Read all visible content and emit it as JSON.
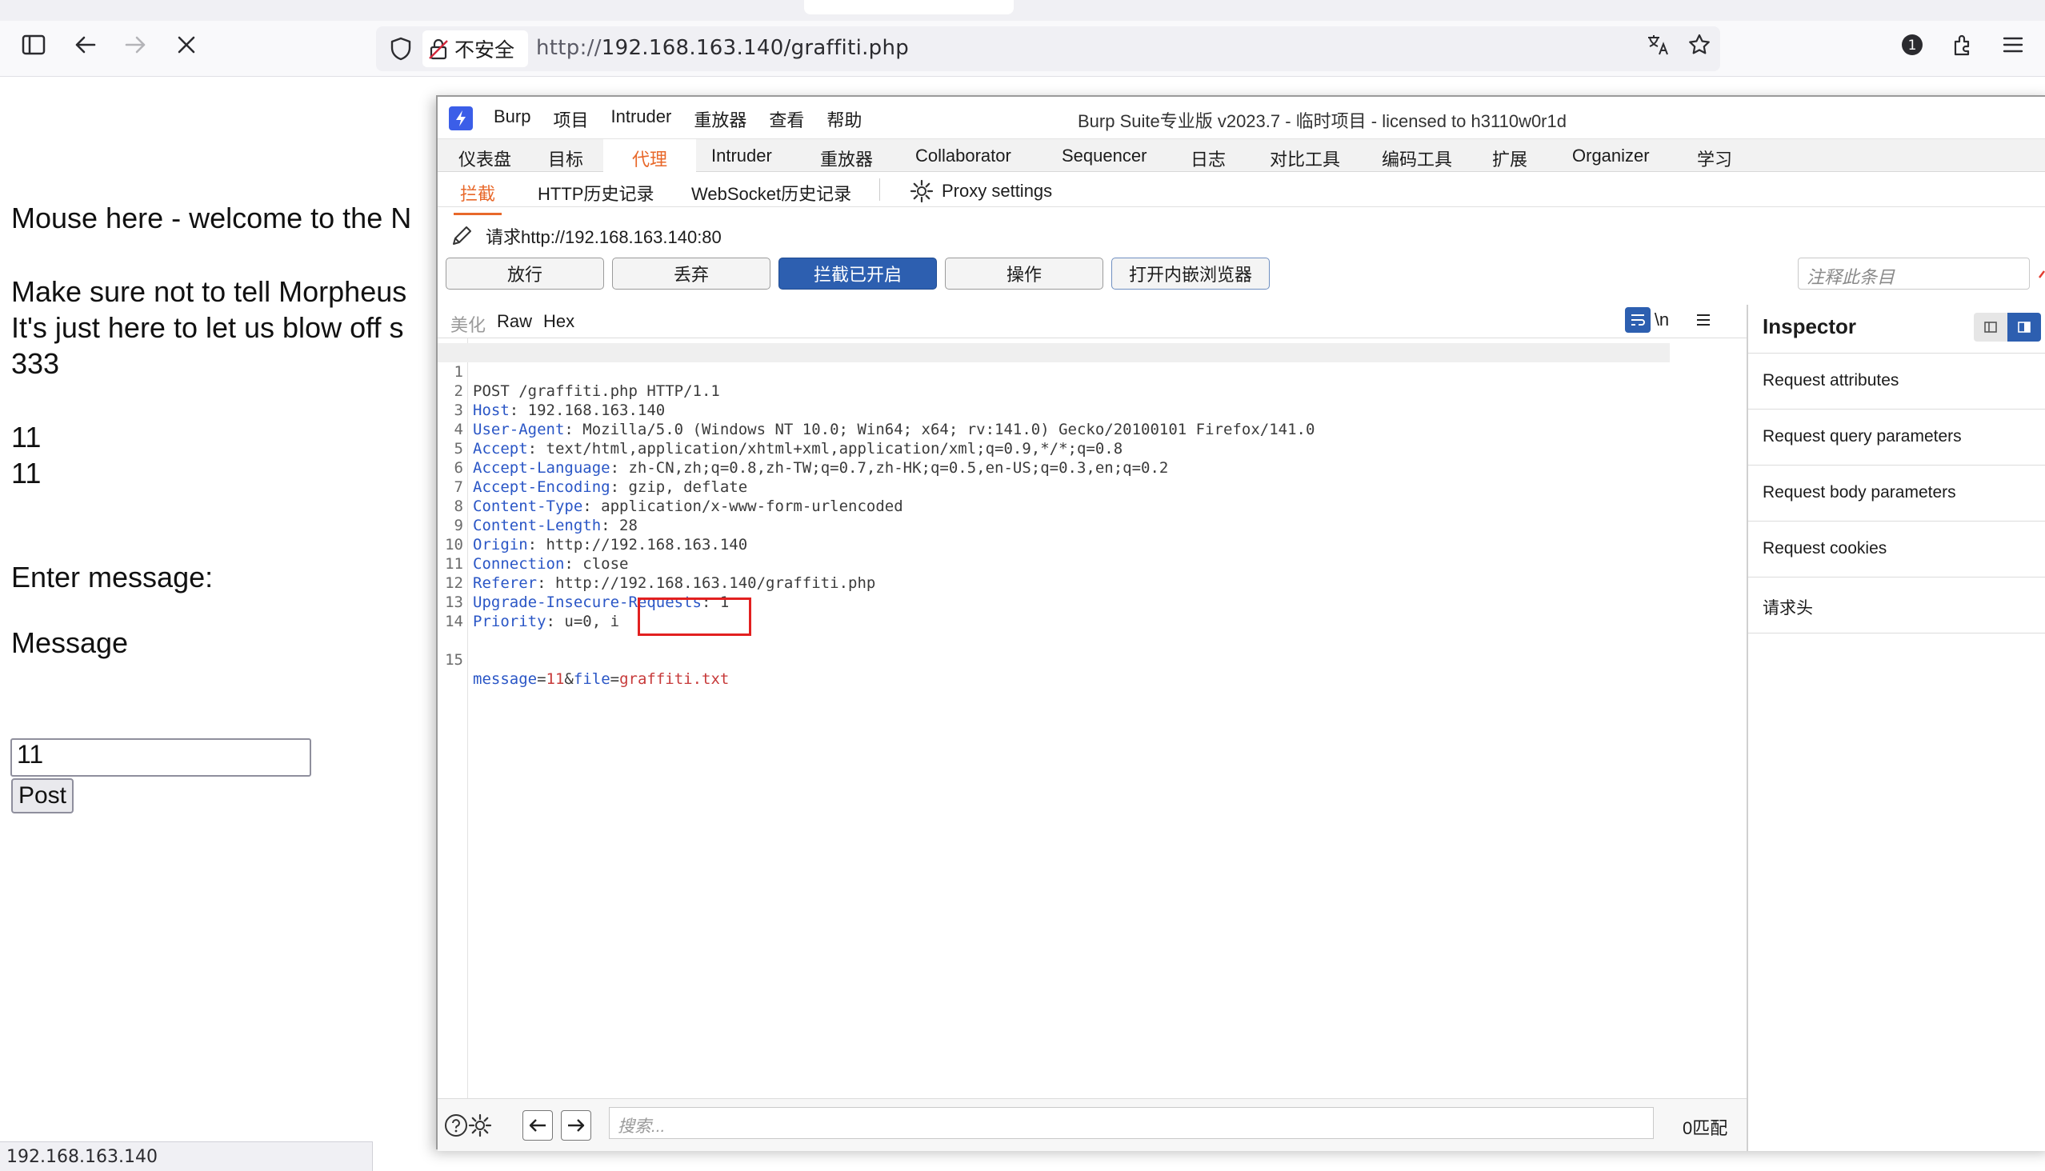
{
  "browser": {
    "security_label": "不安全",
    "url_prefix": "http://",
    "url_host_path": "192.168.163.140/graffiti.php"
  },
  "page": {
    "lines": [
      "Mouse here - welcome to the N",
      "Make sure not to tell Morpheus",
      "It's just here to let us blow off s",
      "333",
      "11",
      "11",
      "Enter message:",
      "Message"
    ],
    "message_value": "11",
    "post_label": "Post",
    "status_url": "192.168.163.140"
  },
  "burp": {
    "menu": [
      "Burp",
      "项目",
      "Intruder",
      "重放器",
      "查看",
      "帮助"
    ],
    "title": "Burp Suite专业版  v2023.7 - 临时项目 - licensed to h3110w0r1d",
    "top_tabs": [
      "仪表盘",
      "目标",
      "代理",
      "Intruder",
      "重放器",
      "Collaborator",
      "Sequencer",
      "日志",
      "对比工具",
      "编码工具",
      "扩展",
      "Organizer",
      "学习"
    ],
    "active_top_tab": "代理",
    "sub_tabs": [
      "拦截",
      "HTTP历史记录",
      "WebSocket历史记录"
    ],
    "proxy_settings": "Proxy settings",
    "request_line": "请求http://192.168.163.140:80",
    "buttons": {
      "forward": "放行",
      "drop": "丢弃",
      "intercept": "拦截已开启",
      "action": "操作",
      "browser": "打开内嵌浏览器"
    },
    "annotation_placeholder": "注释此条目",
    "editor_tabs": [
      "美化",
      "Raw",
      "Hex"
    ],
    "newline_toggle": "\\n",
    "request": [
      {
        "n": "1",
        "name": "",
        "value": "POST /graffiti.php HTTP/1.1"
      },
      {
        "n": "2",
        "name": "Host",
        "value": ": 192.168.163.140"
      },
      {
        "n": "3",
        "name": "User-Agent",
        "value": ": Mozilla/5.0 (Windows NT 10.0; Win64; x64; rv:141.0) Gecko/20100101 Firefox/141.0"
      },
      {
        "n": "4",
        "name": "Accept",
        "value": ": text/html,application/xhtml+xml,application/xml;q=0.9,*/*;q=0.8"
      },
      {
        "n": "5",
        "name": "Accept-Language",
        "value": ": zh-CN,zh;q=0.8,zh-TW;q=0.7,zh-HK;q=0.5,en-US;q=0.3,en;q=0.2"
      },
      {
        "n": "6",
        "name": "Accept-Encoding",
        "value": ": gzip, deflate"
      },
      {
        "n": "7",
        "name": "Content-Type",
        "value": ": application/x-www-form-urlencoded"
      },
      {
        "n": "8",
        "name": "Content-Length",
        "value": ": 28"
      },
      {
        "n": "9",
        "name": "Origin",
        "value": ": http://192.168.163.140"
      },
      {
        "n": "10",
        "name": "Connection",
        "value": ": close"
      },
      {
        "n": "11",
        "name": "Referer",
        "value": ": http://192.168.163.140/graffiti.php"
      },
      {
        "n": "12",
        "name": "Upgrade-Insecure-Requests",
        "value": ": 1"
      },
      {
        "n": "13",
        "name": "Priority",
        "value": ": u=0, i"
      },
      {
        "n": "14",
        "name": "",
        "value": ""
      }
    ],
    "body_line": {
      "n": "15",
      "key1": "message",
      "eq1": "=",
      "val1": "11",
      "amp": "&",
      "key2": "file",
      "eq2": "=",
      "val2": "graffiti.txt"
    },
    "search_placeholder": "搜索...",
    "match_count": "0匹配",
    "inspector": {
      "title": "Inspector",
      "rows": [
        "Request attributes",
        "Request query parameters",
        "Request body parameters",
        "Request cookies",
        "请求头"
      ]
    }
  },
  "colors": {
    "accent_orange": "#e8682a",
    "burp_blue": "#2d5fb0",
    "header_name": "#2a56c6",
    "highlight_red": "#e22020"
  }
}
